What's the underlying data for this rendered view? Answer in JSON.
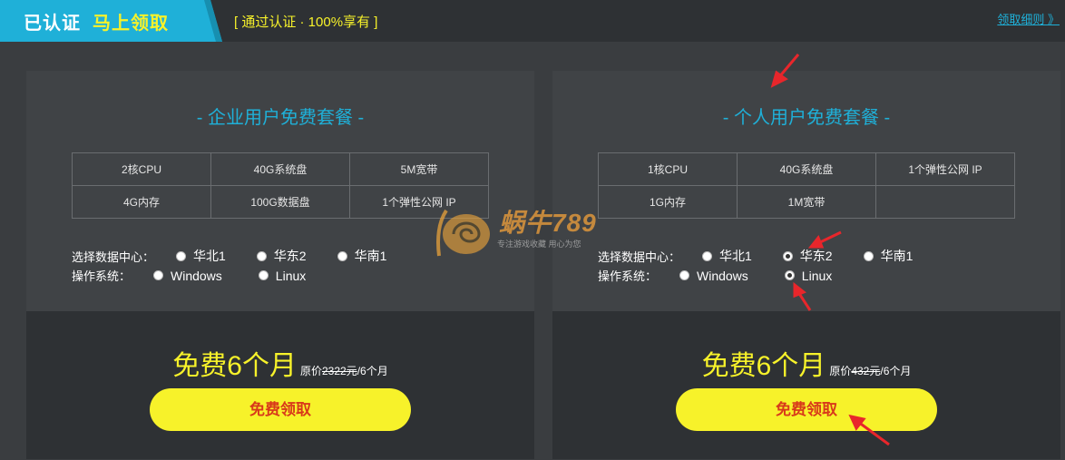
{
  "header": {
    "badge_left": "已认证",
    "badge_right": "马上领取",
    "subtitle": "[ 通过认证 · 100%享有 ]",
    "rules_link": "领取细则 》"
  },
  "colors": {
    "accent_cyan": "#1fb0d8",
    "accent_yellow": "#f7f22a",
    "button_text_red": "#d83a1a",
    "background": "#3a3d40"
  },
  "panels": [
    {
      "title": "- 企业用户免费套餐 -",
      "specs": [
        [
          "2核CPU",
          "40G系统盘",
          "5M宽带"
        ],
        [
          "4G内存",
          "100G数据盘",
          "1个弹性公网 IP"
        ]
      ],
      "dc_label": "选择数据中心：",
      "dc_options": [
        "华北1",
        "华东2",
        "华南1"
      ],
      "dc_selected": -1,
      "os_label": "操作系统：",
      "os_options": [
        "Windows",
        "Linux"
      ],
      "os_selected": -1,
      "price": "免费6个月",
      "orig_prefix": "原价",
      "orig_strike": "2322元",
      "orig_suffix": "/6个月",
      "button": "免费领取"
    },
    {
      "title": "- 个人用户免费套餐 -",
      "specs": [
        [
          "1核CPU",
          "40G系统盘",
          "1个弹性公网 IP"
        ],
        [
          "1G内存",
          "1M宽带",
          ""
        ]
      ],
      "dc_label": "选择数据中心：",
      "dc_options": [
        "华北1",
        "华东2",
        "华南1"
      ],
      "dc_selected": 1,
      "os_label": "操作系统：",
      "os_options": [
        "Windows",
        "Linux"
      ],
      "os_selected": 1,
      "price": "免费6个月",
      "orig_prefix": "原价",
      "orig_strike": "432元",
      "orig_suffix": "/6个月",
      "button": "免费领取"
    }
  ],
  "watermark": {
    "text": "蜗牛789",
    "sub": "专注游戏收藏    用心为您"
  }
}
